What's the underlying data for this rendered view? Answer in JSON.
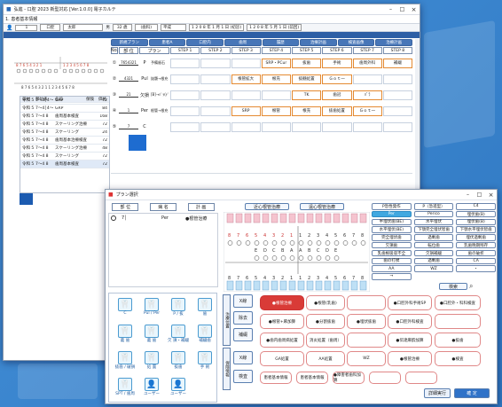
{
  "w1": {
    "title": "弘進 - 口腔 2023 新型対応 [Ver.1.0.0] 電子カルテ",
    "subtitle": "1. 患者基本情報",
    "patient": {
      "no": "1",
      "kana": "口腔",
      "name": "太郎",
      "sex": "男",
      "age": "32 歳",
      "extra": "(歯科)",
      "birth": "平成",
      "dates": [
        "1 2 0 8 年 1 月 1 日 (初診)",
        "1 2 0 8 年 5 月 1 日 (前回)"
      ]
    },
    "toolbar": [
      "新規プラン",
      "患者A",
      "口腔内",
      "歯周",
      "履歴",
      "治療計画",
      "検査画像",
      "治療計画"
    ],
    "plan_cols": {
      "no": "No.",
      "site": "部 位",
      "plan": "プラン",
      "steps": [
        "STEP 1",
        "STEP 2",
        "STEP 3",
        "STEP 4",
        "STEP 5",
        "STEP 6",
        "STEP 7",
        "STEP 8"
      ]
    },
    "plans": [
      {
        "no": "①",
        "site": "7654321",
        "plan": "P",
        "name": "予備歯石",
        "steps": [
          "",
          "",
          "",
          "SRP・PCur",
          "抜歯",
          "手術",
          "歯周外科",
          "補綴"
        ]
      },
      {
        "no": "②",
        "site": "4321",
        "plan": "Pul",
        "name": "抜髄→根充",
        "steps": [
          "",
          "",
          "根管拡大",
          "根充",
          "抜髄処置",
          "Ｇｏｔ一",
          "",
          ""
        ]
      },
      {
        "no": "③",
        "site": "21",
        "plan": "欠損",
        "name": "[B]→ﾊﾞﾗ(ﾃﾞｲ)",
        "steps": [
          "",
          "",
          "",
          "",
          "TK",
          "歯冠",
          "ﾊﾞﾗ",
          ""
        ]
      },
      {
        "no": "④",
        "site": "1",
        "plan": "Per",
        "name": "根管→根充",
        "steps": [
          "",
          "",
          "SRP",
          "根管",
          "根充",
          "抜歯処置",
          "Ｇｏｔ一",
          ""
        ]
      },
      {
        "no": "⑤",
        "site": "7",
        "plan": "C",
        "name": "",
        "steps": [
          "",
          "",
          "",
          "",
          "",
          "",
          "",
          ""
        ]
      }
    ],
    "history_header": [
      "日付",
      "部位表",
      "名前",
      "保険",
      "価格"
    ],
    "history": [
      {
        "date": "令和 5...",
        "site": "7～4│4～7",
        "name": "GRP",
        "price": "72"
      },
      {
        "date": "令和 5...",
        "site": "7～4│4～7",
        "name": "GRP",
        "price": "84"
      },
      {
        "date": "令和 5...",
        "site": "7〜4 8",
        "name": "歯周基本検査",
        "price": "168"
      },
      {
        "date": "令和 5...",
        "site": "7〜4 8",
        "name": "スケーリング治療",
        "price": "72"
      },
      {
        "date": "令和 5...",
        "site": "7〜4 8",
        "name": "スケーリング",
        "price": "24"
      },
      {
        "date": "令和 5...",
        "site": "7〜4 8",
        "name": "歯周基本治療検査",
        "price": "72"
      },
      {
        "date": "令和 5...",
        "site": "7〜4 8",
        "name": "スケーリング治療",
        "price": "48"
      },
      {
        "date": "令和 5...",
        "site": "7〜4 8",
        "name": "スケーリング",
        "price": "72"
      },
      {
        "date": "令和 5...",
        "site": "7〜4 8",
        "name": "歯周基本検査",
        "price": "72"
      }
    ]
  },
  "w2": {
    "title": "プラン選択",
    "col_headers": [
      "部 位",
      "病 名",
      "計 画"
    ],
    "plan_row": {
      "site": "7│",
      "disease": "Per",
      "plan": "●根管治療"
    },
    "tabs": [
      "近心根管治療",
      "遠心根管治療"
    ],
    "tooth_nums_upper": [
      "8",
      "7",
      "6",
      "5",
      "4",
      "3",
      "2",
      "1",
      "1",
      "2",
      "3",
      "4",
      "5",
      "6",
      "7",
      "8"
    ],
    "tooth_letters": [
      "E",
      "D",
      "C",
      "B",
      "A",
      "A",
      "B",
      "C",
      "D",
      "E"
    ],
    "disease_buttons": [
      "P急性発作",
      "P（急進型）",
      "C4",
      "Per",
      "Perico",
      "埋伏歯(B)",
      "半埋伏歯(BE)",
      "水平埋伏",
      "埋伏歯(B)",
      "水平埋伏(BE)",
      "下顎完全埋伏智歯",
      "下顎水平埋伏智歯",
      "完全埋伏歯",
      "過剰歯",
      "埋伏過剰歯",
      "欠損歯",
      "転位歯",
      "乳歯晩期残存",
      "乳歯根吸収不全",
      "欠損補綴",
      "歯の破折",
      "歯の打撲",
      "過剰歯",
      "CA",
      "AA",
      "WZ",
      "・",
      "→"
    ],
    "search_label": "検索",
    "icons": [
      {
        "label": "C"
      },
      {
        "label": "Pul / Per"
      },
      {
        "label": "P / 抜"
      },
      {
        "label": "歯"
      },
      {
        "label": "義 歯"
      },
      {
        "label": "義 歯"
      },
      {
        "label": "欠 損・補綴"
      },
      {
        "label": "補綴歯"
      },
      {
        "label": "抜歯 / 破損"
      },
      {
        "label": "処 置"
      },
      {
        "label": "抜歯"
      },
      {
        "label": "手 術"
      },
      {
        "label": "SPT / 歯周"
      },
      {
        "label": "ユーザー"
      },
      {
        "label": "ユーザー"
      }
    ],
    "side_labels": [
      "治療位置",
      "保険情報"
    ],
    "side_buttons_a": [
      "X線",
      "除去",
      "補綴"
    ],
    "side_buttons_b": [
      "X線",
      "検査"
    ],
    "treatment_buttons": [
      "●根管治療",
      "●根管(乳歯)",
      "",
      "●口腔外科手術SP",
      "●口腔外・科科検査",
      "●根管+麻加算",
      "●分割抜歯",
      "●埋伏抜歯",
      "●口腔外科検査",
      "",
      "●歯内歯周病処置",
      "消炎処置（歯周）",
      "",
      "●伝達麻酔加算",
      "●抜歯",
      "GA処置",
      "AA処置",
      "WZ",
      "●根管治療",
      "●検査"
    ],
    "bottom_buttons": [
      "患者基本情報",
      "患者基本情報",
      "●障害者歯科加算",
      "",
      ""
    ],
    "footer_buttons": [
      "詳細実行",
      "確 定"
    ]
  }
}
